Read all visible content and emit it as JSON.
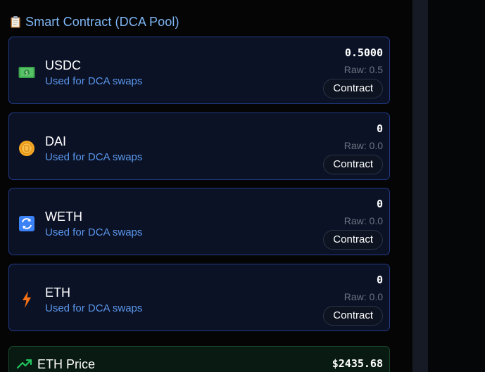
{
  "section": {
    "title": "Smart Contract (DCA Pool)",
    "icon": "clipboard-icon"
  },
  "tokens": [
    {
      "name": "USDC",
      "subtitle": "Used for DCA swaps",
      "amount": "0.5000",
      "raw": "Raw: 0.5",
      "button_label": "Contract",
      "icon": "money-icon"
    },
    {
      "name": "DAI",
      "subtitle": "Used for DCA swaps",
      "amount": "0",
      "raw": "Raw: 0.0",
      "button_label": "Contract",
      "icon": "coin-icon"
    },
    {
      "name": "WETH",
      "subtitle": "Used for DCA swaps",
      "amount": "0",
      "raw": "Raw: 0.0",
      "button_label": "Contract",
      "icon": "swap-arrows-icon"
    },
    {
      "name": "ETH",
      "subtitle": "Used for DCA swaps",
      "amount": "0",
      "raw": "Raw: 0.0",
      "button_label": "Contract",
      "icon": "lightning-icon"
    }
  ],
  "eth_price": {
    "label": "ETH Price",
    "value": "$2435.68",
    "icon": "trending-up-icon"
  },
  "colors": {
    "card_border": "#233b8a",
    "accent_blue": "#7eb6f5",
    "price_green": "#22c55e"
  }
}
